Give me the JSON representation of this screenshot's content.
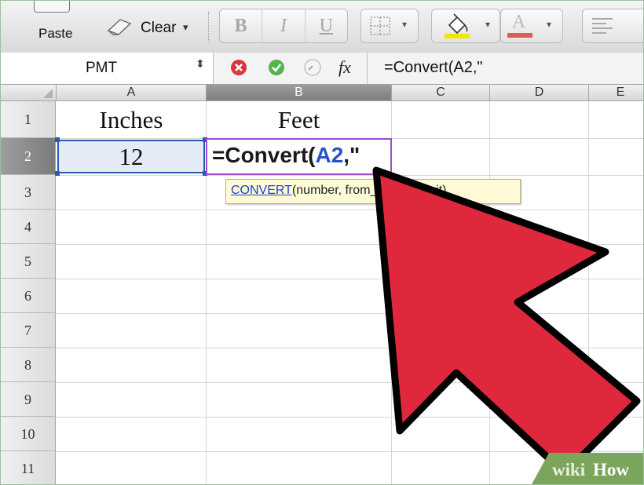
{
  "toolbar": {
    "paste_label": "Paste",
    "clear_label": "Clear",
    "bold": "B",
    "italic": "I",
    "underline": "U",
    "font_color_letter": "A",
    "fill_color": "#f2e600",
    "font_color": "#e15a5a",
    "caret": "▾"
  },
  "formula_bar": {
    "name_box": "PMT",
    "name_box_stepper": "⬍",
    "fx_label": "fx",
    "formula": "=Convert(A2,\""
  },
  "sheet": {
    "columns": [
      "A",
      "B",
      "C",
      "D",
      "E"
    ],
    "active_column": "B",
    "rows": [
      "1",
      "2",
      "3",
      "4",
      "5",
      "6",
      "7",
      "8",
      "9",
      "10",
      "11"
    ],
    "active_row": "2",
    "cells": {
      "A1": "Inches",
      "B1": "Feet",
      "A2": "12",
      "B2_prefix": "=Convert(",
      "B2_ref": "A2",
      "B2_suffix": ",\""
    },
    "selection_color": "#2c58b5",
    "edit_color": "#9a4dcf"
  },
  "tooltip": {
    "function_link": "CONVERT",
    "arguments": "(number, from_unit, to_unit)"
  },
  "overlay": {
    "arrow_color": "#e0283d"
  },
  "watermark": {
    "part1": "wiki",
    "part2": "How"
  }
}
